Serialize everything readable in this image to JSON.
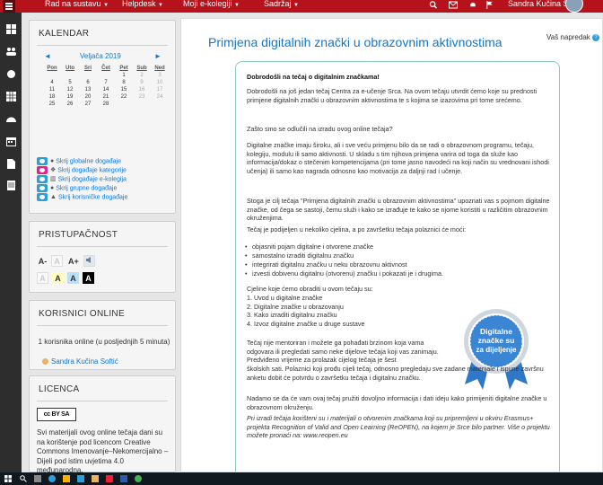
{
  "topbar": {
    "menus": [
      "Rad na sustavu",
      "Helpdesk",
      "Moji e-kolegiji",
      "Sadržaj"
    ],
    "user_name": "Sandra Kučina Softić"
  },
  "leftnav": {
    "icons": [
      "dashboard-icon",
      "users-icon",
      "badge-icon",
      "grades-icon",
      "dashboard-gauge-icon",
      "calendar-icon",
      "file-icon",
      "book-icon"
    ]
  },
  "calendar": {
    "title": "KALENDAR",
    "prev": "◄",
    "month": "Veljača 2019",
    "next": "►",
    "days": [
      "Pon",
      "Uto",
      "Sri",
      "Čet",
      "Pet",
      "Sub",
      "Ned"
    ],
    "weeks": [
      [
        "",
        "",
        "",
        "",
        "1",
        "2",
        "3"
      ],
      [
        "4",
        "5",
        "6",
        "7",
        "8",
        "9",
        "10"
      ],
      [
        "11",
        "12",
        "13",
        "14",
        "15",
        "16",
        "17"
      ],
      [
        "18",
        "19",
        "20",
        "21",
        "22",
        "23",
        "24"
      ],
      [
        "25",
        "26",
        "27",
        "28",
        "",
        "",
        ""
      ]
    ],
    "events": [
      {
        "label": "Skrij globalne događaje",
        "color": "#2e9fd6",
        "icon": "globe-icon",
        "glyph": "●"
      },
      {
        "label": "Skrij događaje kategorije",
        "color": "#e0248f",
        "icon": "cubes-icon",
        "glyph": "❖"
      },
      {
        "label": "Skrij događaje e-kolegija",
        "color": "#2e9fd6",
        "icon": "university-icon",
        "glyph": "▥"
      },
      {
        "label": "Skrij grupne događaje",
        "color": "#2e9fd6",
        "icon": "group-icon",
        "glyph": "●"
      },
      {
        "label": "Skrij korisničke događaje",
        "color": "#2e9fd6",
        "icon": "user-icon",
        "glyph": "▲"
      }
    ]
  },
  "accessibility": {
    "title": "PRISTUPAČNOST",
    "row1": [
      "A-",
      "A",
      "A+"
    ],
    "row2": [
      "A",
      "A",
      "A",
      "A"
    ]
  },
  "online": {
    "title": "KORISNICI ONLINE",
    "text": "1 korisnika online (u posljednjih 5 minuta)",
    "user": "Sandra Kučina Softić"
  },
  "license": {
    "title": "LICENCA",
    "badge": "cc BY SA",
    "text": "Svi materijali ovog online tečaja dani su na korištenje pod licencom Creative Commons Imenovanje–Nekomercijalno – Dijeli pod istim uvjetima 4.0 međunarodna."
  },
  "main": {
    "title": "Primjena digitalnih znački u obrazovnim aktivnostima",
    "progress_label": "Vaš napredak",
    "heading": "Dobrodošli na tečaj o digitalnim značkama!",
    "p1": "Dobrodošli na još jedan tečaj Centra za e-učenje Srca. Na ovom tečaju utvrdit ćemo koje su prednosti primjene digitalnih znački u obrazovnim aktivnostima te s kojima se izazovima pri tome srećemo.",
    "p2": "Zašto smo se odlučili na izradu ovog online tečaja?",
    "p3": "Digitalne značke imaju široku, ali i sve veću primjenu bilo da se radi o obrazovnom programu, tečaju, kolegiju, modulu ili samo aktivnosti. U skladu s tim njihova primjena varira od toga da služe kao informacija/dokaz o stečenim kompetencijama (pri tome jasno navodeći na koji način su vrednovani ishodi učenja) ili samo kao nagrada odnosno kao motivacija za daljnji rad i učenje.",
    "p4": "Stoga je cilj  tečaja \"Primjena digitalnih znački u obrazovnim aktivnostima\" upoznati vas s pojmom digitalne značke, od čega se sastoji,  čemu služi i kako se izrađuje te kako se njome koristiti u različitim obrazovnim okruženjima.",
    "p5": "Tečaj je podijeljen u nekoliko cjelina, a po završetku tečaja polaznici će moći:",
    "bullets": [
      "objasniti pojam digitalne i otvorene značke",
      "samostalno izraditi digitalnu značku",
      "integrirati digitalnu značku u neku obrazovnu aktivnost",
      "izvesti dobivenu digitalnu (otvorenu) značku i pokazati je i drugima."
    ],
    "p6": "Cjeline koje ćemo obraditi u ovom tečaju su:",
    "units": [
      "1. Uvod u digitalne značke",
      "2. Digitalne značke u obrazovanju",
      "3. Kako izraditi digitalnu značku",
      "4. Izvoz digitalne značke u druge sustave"
    ],
    "badge_text": [
      "Digitalne",
      "značke su",
      "za dijeljenje"
    ],
    "p7": "Tečaj nije mentoriran i možete ga pohađati brzinom koja vama odgovara ili pregledati samo neke dijelove tečaja koji vas zanimaju. Predviđeno vrijeme za prolazak cijelog tečaja je šest školskih sati. Polaznici koji prođu cijeli tečaj, odnosno pregledaju sve zadane materijale i ispune završnu anketu dobit će potvrdu o završetku tečaja i digitalnu značku.",
    "p8": "Nadamo se da će vam ovaj tečaj pružiti dovoljno informacija i dati ideju kako primijeniti digitalne značke u obrazovnom okruženju.",
    "p9": "Pri izradi tečaja korišteni su i materijali o otvorenim  značkama koji su pripremljeni u okviru Erasmus+ projekta Recognition of Valid and Open Learning (ReOPEN), na kojem je Srce bilo partner. Više o projektu možete pronaći na: www.reopen.eu"
  },
  "colors": {
    "topbar": "#b5121b",
    "link": "#1177d1",
    "border_course": "#8ec9b8",
    "badge": "#2e78c7"
  }
}
